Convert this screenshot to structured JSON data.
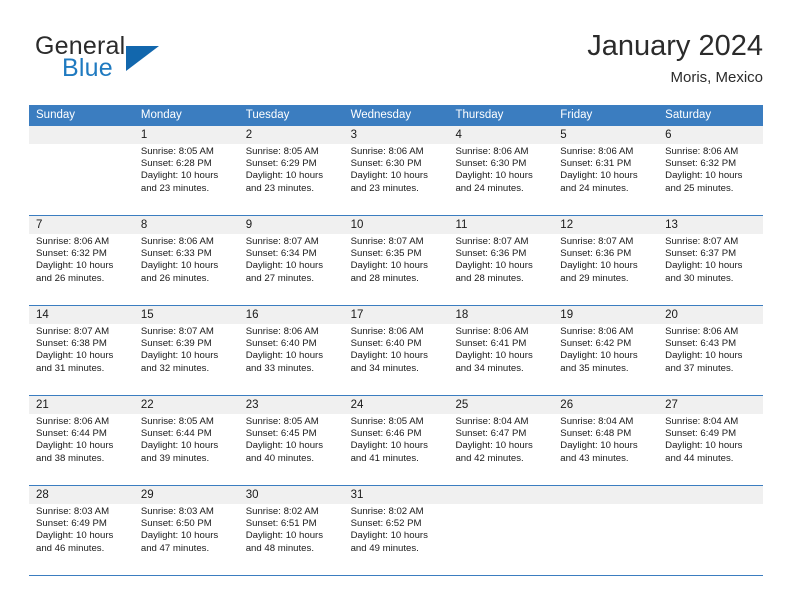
{
  "brand": {
    "name_part1": "General",
    "name_part2": "Blue",
    "accent_color": "#1267ad",
    "text_color": "#2b2b2b",
    "blue_text_color": "#1f7ac0"
  },
  "header": {
    "title": "January 2024",
    "subtitle": "Moris, Mexico"
  },
  "theme": {
    "header_bg": "#3b7dc0",
    "header_text": "#ffffff",
    "daynum_band_bg": "#f0f0f0",
    "cell_bg": "#ffffff",
    "grid_line": "#3b7dc0"
  },
  "weekdays": [
    "Sunday",
    "Monday",
    "Tuesday",
    "Wednesday",
    "Thursday",
    "Friday",
    "Saturday"
  ],
  "weeks": [
    {
      "days": [
        {
          "num": "",
          "sunrise": "",
          "sunset": "",
          "daylight_line1": "",
          "daylight_line2": ""
        },
        {
          "num": "1",
          "sunrise": "Sunrise: 8:05 AM",
          "sunset": "Sunset: 6:28 PM",
          "daylight_line1": "Daylight: 10 hours",
          "daylight_line2": "and 23 minutes."
        },
        {
          "num": "2",
          "sunrise": "Sunrise: 8:05 AM",
          "sunset": "Sunset: 6:29 PM",
          "daylight_line1": "Daylight: 10 hours",
          "daylight_line2": "and 23 minutes."
        },
        {
          "num": "3",
          "sunrise": "Sunrise: 8:06 AM",
          "sunset": "Sunset: 6:30 PM",
          "daylight_line1": "Daylight: 10 hours",
          "daylight_line2": "and 23 minutes."
        },
        {
          "num": "4",
          "sunrise": "Sunrise: 8:06 AM",
          "sunset": "Sunset: 6:30 PM",
          "daylight_line1": "Daylight: 10 hours",
          "daylight_line2": "and 24 minutes."
        },
        {
          "num": "5",
          "sunrise": "Sunrise: 8:06 AM",
          "sunset": "Sunset: 6:31 PM",
          "daylight_line1": "Daylight: 10 hours",
          "daylight_line2": "and 24 minutes."
        },
        {
          "num": "6",
          "sunrise": "Sunrise: 8:06 AM",
          "sunset": "Sunset: 6:32 PM",
          "daylight_line1": "Daylight: 10 hours",
          "daylight_line2": "and 25 minutes."
        }
      ]
    },
    {
      "days": [
        {
          "num": "7",
          "sunrise": "Sunrise: 8:06 AM",
          "sunset": "Sunset: 6:32 PM",
          "daylight_line1": "Daylight: 10 hours",
          "daylight_line2": "and 26 minutes."
        },
        {
          "num": "8",
          "sunrise": "Sunrise: 8:06 AM",
          "sunset": "Sunset: 6:33 PM",
          "daylight_line1": "Daylight: 10 hours",
          "daylight_line2": "and 26 minutes."
        },
        {
          "num": "9",
          "sunrise": "Sunrise: 8:07 AM",
          "sunset": "Sunset: 6:34 PM",
          "daylight_line1": "Daylight: 10 hours",
          "daylight_line2": "and 27 minutes."
        },
        {
          "num": "10",
          "sunrise": "Sunrise: 8:07 AM",
          "sunset": "Sunset: 6:35 PM",
          "daylight_line1": "Daylight: 10 hours",
          "daylight_line2": "and 28 minutes."
        },
        {
          "num": "11",
          "sunrise": "Sunrise: 8:07 AM",
          "sunset": "Sunset: 6:36 PM",
          "daylight_line1": "Daylight: 10 hours",
          "daylight_line2": "and 28 minutes."
        },
        {
          "num": "12",
          "sunrise": "Sunrise: 8:07 AM",
          "sunset": "Sunset: 6:36 PM",
          "daylight_line1": "Daylight: 10 hours",
          "daylight_line2": "and 29 minutes."
        },
        {
          "num": "13",
          "sunrise": "Sunrise: 8:07 AM",
          "sunset": "Sunset: 6:37 PM",
          "daylight_line1": "Daylight: 10 hours",
          "daylight_line2": "and 30 minutes."
        }
      ]
    },
    {
      "days": [
        {
          "num": "14",
          "sunrise": "Sunrise: 8:07 AM",
          "sunset": "Sunset: 6:38 PM",
          "daylight_line1": "Daylight: 10 hours",
          "daylight_line2": "and 31 minutes."
        },
        {
          "num": "15",
          "sunrise": "Sunrise: 8:07 AM",
          "sunset": "Sunset: 6:39 PM",
          "daylight_line1": "Daylight: 10 hours",
          "daylight_line2": "and 32 minutes."
        },
        {
          "num": "16",
          "sunrise": "Sunrise: 8:06 AM",
          "sunset": "Sunset: 6:40 PM",
          "daylight_line1": "Daylight: 10 hours",
          "daylight_line2": "and 33 minutes."
        },
        {
          "num": "17",
          "sunrise": "Sunrise: 8:06 AM",
          "sunset": "Sunset: 6:40 PM",
          "daylight_line1": "Daylight: 10 hours",
          "daylight_line2": "and 34 minutes."
        },
        {
          "num": "18",
          "sunrise": "Sunrise: 8:06 AM",
          "sunset": "Sunset: 6:41 PM",
          "daylight_line1": "Daylight: 10 hours",
          "daylight_line2": "and 34 minutes."
        },
        {
          "num": "19",
          "sunrise": "Sunrise: 8:06 AM",
          "sunset": "Sunset: 6:42 PM",
          "daylight_line1": "Daylight: 10 hours",
          "daylight_line2": "and 35 minutes."
        },
        {
          "num": "20",
          "sunrise": "Sunrise: 8:06 AM",
          "sunset": "Sunset: 6:43 PM",
          "daylight_line1": "Daylight: 10 hours",
          "daylight_line2": "and 37 minutes."
        }
      ]
    },
    {
      "days": [
        {
          "num": "21",
          "sunrise": "Sunrise: 8:06 AM",
          "sunset": "Sunset: 6:44 PM",
          "daylight_line1": "Daylight: 10 hours",
          "daylight_line2": "and 38 minutes."
        },
        {
          "num": "22",
          "sunrise": "Sunrise: 8:05 AM",
          "sunset": "Sunset: 6:44 PM",
          "daylight_line1": "Daylight: 10 hours",
          "daylight_line2": "and 39 minutes."
        },
        {
          "num": "23",
          "sunrise": "Sunrise: 8:05 AM",
          "sunset": "Sunset: 6:45 PM",
          "daylight_line1": "Daylight: 10 hours",
          "daylight_line2": "and 40 minutes."
        },
        {
          "num": "24",
          "sunrise": "Sunrise: 8:05 AM",
          "sunset": "Sunset: 6:46 PM",
          "daylight_line1": "Daylight: 10 hours",
          "daylight_line2": "and 41 minutes."
        },
        {
          "num": "25",
          "sunrise": "Sunrise: 8:04 AM",
          "sunset": "Sunset: 6:47 PM",
          "daylight_line1": "Daylight: 10 hours",
          "daylight_line2": "and 42 minutes."
        },
        {
          "num": "26",
          "sunrise": "Sunrise: 8:04 AM",
          "sunset": "Sunset: 6:48 PM",
          "daylight_line1": "Daylight: 10 hours",
          "daylight_line2": "and 43 minutes."
        },
        {
          "num": "27",
          "sunrise": "Sunrise: 8:04 AM",
          "sunset": "Sunset: 6:49 PM",
          "daylight_line1": "Daylight: 10 hours",
          "daylight_line2": "and 44 minutes."
        }
      ]
    },
    {
      "days": [
        {
          "num": "28",
          "sunrise": "Sunrise: 8:03 AM",
          "sunset": "Sunset: 6:49 PM",
          "daylight_line1": "Daylight: 10 hours",
          "daylight_line2": "and 46 minutes."
        },
        {
          "num": "29",
          "sunrise": "Sunrise: 8:03 AM",
          "sunset": "Sunset: 6:50 PM",
          "daylight_line1": "Daylight: 10 hours",
          "daylight_line2": "and 47 minutes."
        },
        {
          "num": "30",
          "sunrise": "Sunrise: 8:02 AM",
          "sunset": "Sunset: 6:51 PM",
          "daylight_line1": "Daylight: 10 hours",
          "daylight_line2": "and 48 minutes."
        },
        {
          "num": "31",
          "sunrise": "Sunrise: 8:02 AM",
          "sunset": "Sunset: 6:52 PM",
          "daylight_line1": "Daylight: 10 hours",
          "daylight_line2": "and 49 minutes."
        },
        {
          "num": "",
          "sunrise": "",
          "sunset": "",
          "daylight_line1": "",
          "daylight_line2": ""
        },
        {
          "num": "",
          "sunrise": "",
          "sunset": "",
          "daylight_line1": "",
          "daylight_line2": ""
        },
        {
          "num": "",
          "sunrise": "",
          "sunset": "",
          "daylight_line1": "",
          "daylight_line2": ""
        }
      ]
    }
  ]
}
